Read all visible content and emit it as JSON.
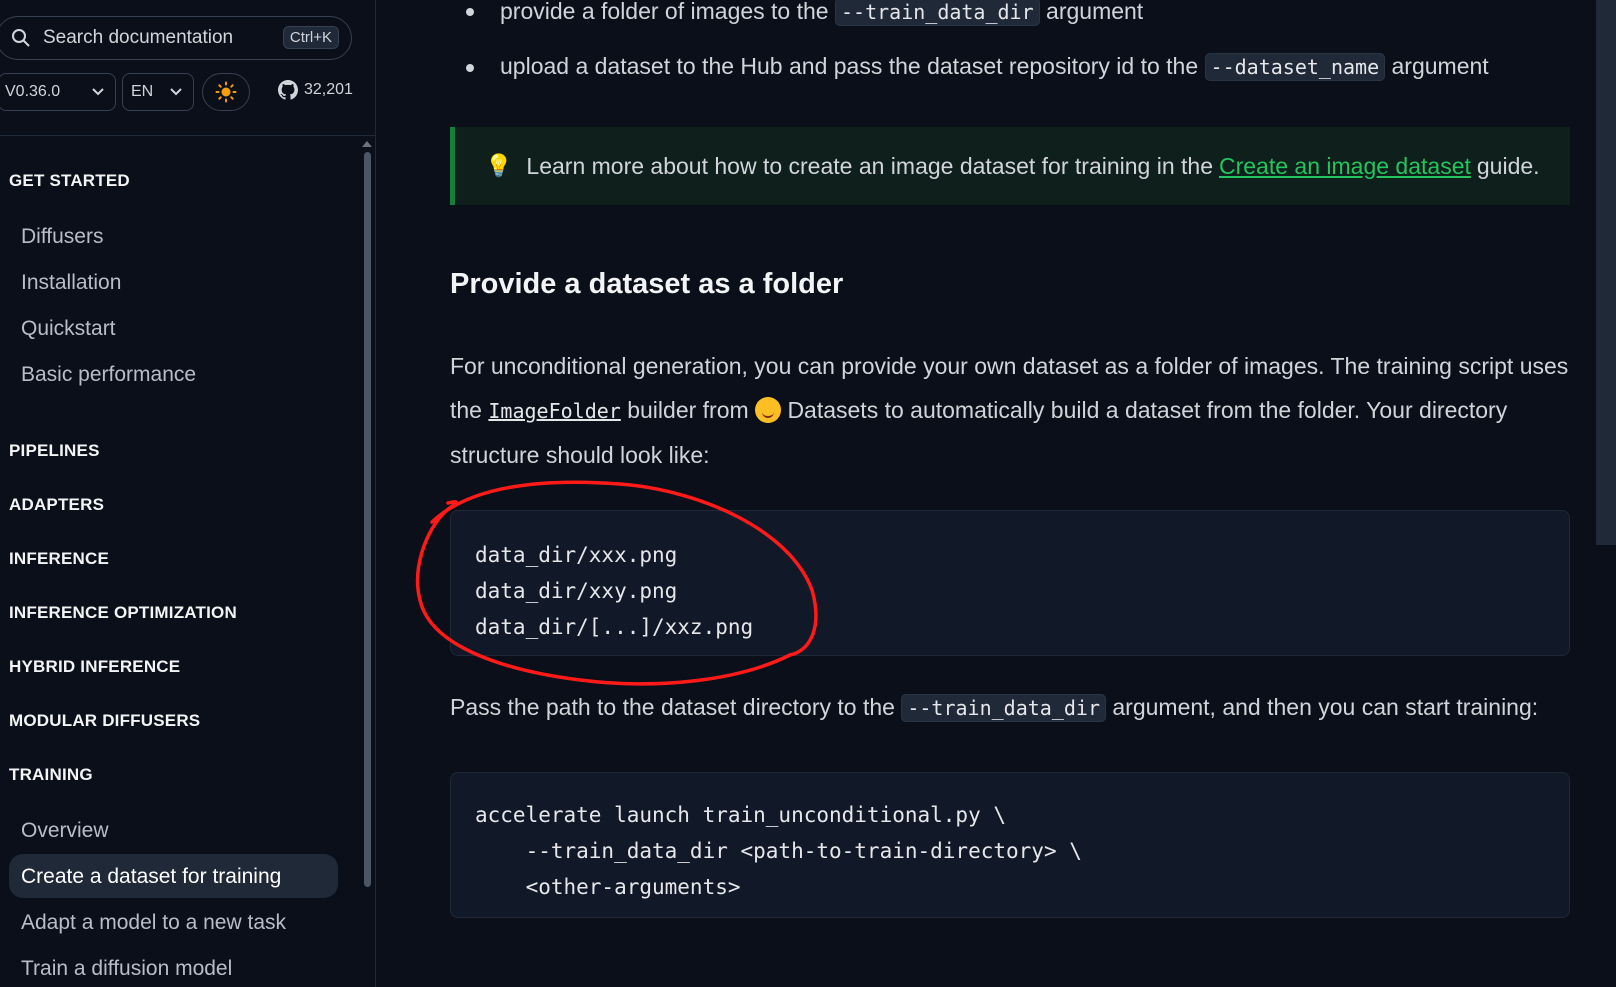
{
  "sidebar": {
    "search_placeholder": "Search documentation",
    "search_shortcut": "Ctrl+K",
    "version": "V0.36.0",
    "language": "EN",
    "github_stars": "32,201",
    "sections": {
      "get_started": "GET STARTED",
      "pipelines": "PIPELINES",
      "adapters": "ADAPTERS",
      "inference": "INFERENCE",
      "inference_optimization": "INFERENCE OPTIMIZATION",
      "hybrid_inference": "HYBRID INFERENCE",
      "modular_diffusers": "MODULAR DIFFUSERS",
      "training": "TRAINING"
    },
    "get_started_items": [
      "Diffusers",
      "Installation",
      "Quickstart",
      "Basic performance"
    ],
    "training_items": [
      "Overview",
      "Create a dataset for training",
      "Adapt a model to a new task",
      "Train a diffusion model"
    ]
  },
  "content": {
    "bullet1_pre": "provide a folder of images to the",
    "bullet1_code": "--train_data_dir",
    "bullet1_post": "argument",
    "bullet2_pre": "upload a dataset to the Hub and pass the dataset repository id to the",
    "bullet2_code": "--dataset_name",
    "bullet2_post": "argument",
    "tip_pre": "Learn more about how to create an image dataset for training in the",
    "tip_link": "Create an image dataset",
    "tip_post": "guide.",
    "heading": "Provide a dataset as a folder",
    "para1_a": "For unconditional generation, you can provide your own dataset as a folder of images. The training script uses the",
    "para1_code": "ImageFolder",
    "para1_b": "builder from",
    "para1_c": "Datasets to automatically build a dataset from the folder. Your directory structure should look like:",
    "code1": [
      "data_dir/xxx.png",
      "data_dir/xxy.png",
      "data_dir/[...]/xxz.png"
    ],
    "para2_pre": "Pass the path to the dataset directory to the",
    "para2_code": "--train_data_dir",
    "para2_post": "argument, and then you can start training:",
    "code2": [
      "accelerate launch train_unconditional.py \\",
      "    --train_data_dir <path-to-train-directory> \\",
      "    <other-arguments>"
    ]
  },
  "colors": {
    "background": "#0b0f19",
    "accent_green": "#22c55e",
    "annotation_red": "#ff1a1a"
  }
}
